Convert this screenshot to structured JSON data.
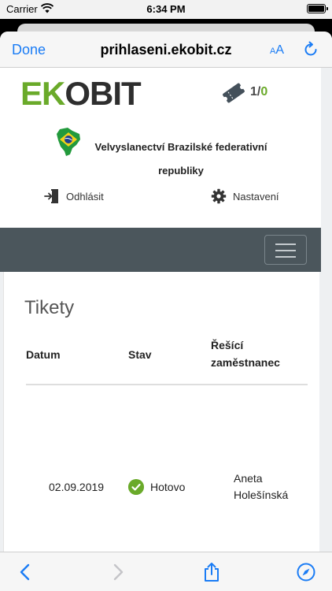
{
  "status_bar": {
    "carrier": "Carrier",
    "time": "6:34 PM"
  },
  "browser": {
    "done_label": "Done",
    "url": "prihlaseni.ekobit.cz",
    "text_size_label_small": "A",
    "text_size_label_large": "A"
  },
  "site": {
    "logo_text": {
      "part1": "EK",
      "part2": "O",
      "part3": "BIT"
    },
    "tickets": {
      "open": "1",
      "sep": "/",
      "closed": "0"
    },
    "organization": "Velvyslanectví Brazilské federativní republiky",
    "logout_label": "Odhlásit",
    "settings_label": "Nastavení"
  },
  "tickets_table": {
    "title": "Tikety",
    "columns": {
      "date": "Datum",
      "status": "Stav",
      "worker": "Řešící zaměstnanec"
    },
    "rows": [
      {
        "date": "02.09.2019",
        "status": "Hotovo",
        "worker": "Aneta Holešínská"
      }
    ]
  },
  "colors": {
    "accent": "#1a7cf5",
    "brand_green": "#6aaa2a",
    "brand_dark": "#2e2e2e",
    "menubar": "#4b565c"
  },
  "icons": {
    "wifi": "wifi-icon",
    "battery": "battery-icon",
    "reload": "reload-icon",
    "ticket": "ticket-icon",
    "logout": "logout-icon",
    "settings": "gear-icon",
    "hamburger": "hamburger-icon",
    "check": "check-icon",
    "back": "back-arrow-icon",
    "forward": "forward-arrow-icon",
    "share": "share-icon",
    "safari": "compass-icon"
  }
}
